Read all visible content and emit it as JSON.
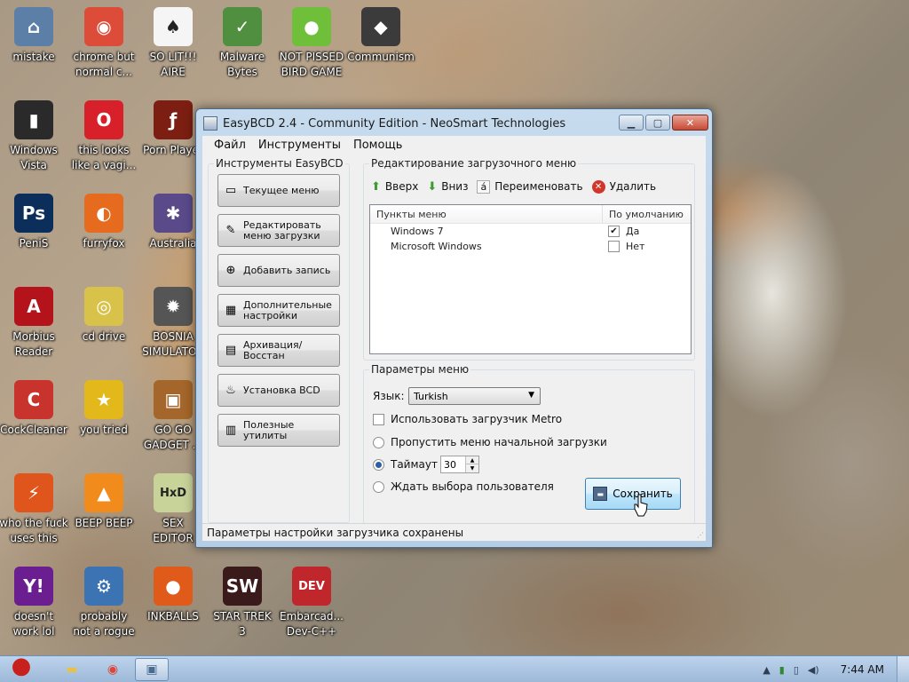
{
  "desktop_icons": [
    {
      "label": "mistake",
      "glyph": "⌂",
      "icon": "computer-icon",
      "bg": "#5c7fa8"
    },
    {
      "label": "chrome but\nnormal c...",
      "glyph": "◉",
      "icon": "chrome-icon",
      "bg": "#dd4b39"
    },
    {
      "label": "SO LIT!!!\nAIRE",
      "glyph": "♠",
      "icon": "solitaire-icon",
      "bg": "#f5f5f5"
    },
    {
      "label": "Malware\nBytes",
      "glyph": "✓",
      "icon": "shield-icon",
      "bg": "#4f8f3f"
    },
    {
      "label": "NOT PISSED\nBIRD GAME",
      "glyph": "●",
      "icon": "pig-icon",
      "bg": "#6fbf3a"
    },
    {
      "label": "Communism",
      "glyph": "◆",
      "icon": "communism-icon",
      "bg": "#3b3b3b"
    },
    {
      "label": "Windows\nVista",
      "glyph": "▮",
      "icon": "trash-icon",
      "bg": "#2a2a2a"
    },
    {
      "label": "this looks\nlike a vagi...",
      "glyph": "O",
      "icon": "opera-icon",
      "bg": "#d8202b"
    },
    {
      "label": "Porn Player",
      "glyph": "ƒ",
      "icon": "flash-icon",
      "bg": "#7c1e12"
    },
    {
      "label": "PeniS",
      "glyph": "Ps",
      "icon": "photoshop-icon",
      "bg": "#0b2f5a"
    },
    {
      "label": "furryfox",
      "glyph": "◐",
      "icon": "firefox-icon",
      "bg": "#e66b1f"
    },
    {
      "label": "Australia",
      "glyph": "✱",
      "icon": "spider-icon",
      "bg": "#5a4a8a"
    },
    {
      "label": "Morbius\nReader",
      "glyph": "A",
      "icon": "pdf-icon",
      "bg": "#b5131b"
    },
    {
      "label": "cd drive",
      "glyph": "◎",
      "icon": "cd-icon",
      "bg": "#d8c24a"
    },
    {
      "label": "BOSNIA\nSIMULATOR",
      "glyph": "✹",
      "icon": "mine-icon",
      "bg": "#555555"
    },
    {
      "label": "CockCleaner",
      "glyph": "C",
      "icon": "ccleaner-icon",
      "bg": "#c8332e"
    },
    {
      "label": "you tried",
      "glyph": "★",
      "icon": "star-icon",
      "bg": "#e3b81b"
    },
    {
      "label": "GO GO\nGADGET ...",
      "glyph": "▣",
      "icon": "gadget-icon",
      "bg": "#a4662a"
    },
    {
      "label": "who the fuck\nuses this",
      "glyph": "⚡",
      "icon": "lightning-icon",
      "bg": "#e0551c"
    },
    {
      "label": "BEEP BEEP",
      "glyph": "▲",
      "icon": "vlc-icon",
      "bg": "#f08b1c"
    },
    {
      "label": "SEX\nEDITOR",
      "glyph": "HxD",
      "icon": "hex-editor-icon",
      "bg": "#c8d39a"
    },
    {
      "label": "doesn't\nwork lol",
      "glyph": "Y!",
      "icon": "yahoo-icon",
      "bg": "#6b1e8f"
    },
    {
      "label": "probably\nnot a rogue",
      "glyph": "⚙",
      "icon": "gear-icon",
      "bg": "#3c74b3"
    },
    {
      "label": "INKBALLS",
      "glyph": "●",
      "icon": "inkball-icon",
      "bg": "#e05a1a"
    },
    {
      "label": "STAR TREK\n3",
      "glyph": "SW",
      "icon": "star-wars-icon",
      "bg": "#3a1a1a"
    },
    {
      "label": "Embarcad...\nDev-C++",
      "glyph": "DEV",
      "icon": "devcpp-icon",
      "bg": "#c0272d"
    }
  ],
  "window": {
    "title": "EasyBCD 2.4 - Community Edition - NeoSmart Technologies",
    "menu": [
      "Файл",
      "Инструменты",
      "Помощь"
    ],
    "tools_group_title": "Инструменты EasyBCD",
    "tools": [
      {
        "label": "Текущее меню",
        "glyph": "▭",
        "name": "view-settings-button"
      },
      {
        "label": "Редактировать\nменю загрузки",
        "glyph": "✎",
        "name": "edit-boot-menu-button"
      },
      {
        "label": "Добавить запись",
        "glyph": "⊕",
        "name": "add-entry-button"
      },
      {
        "label": "Дополнительные\nнастройки",
        "glyph": "▦",
        "name": "advanced-settings-button"
      },
      {
        "label": "Архивация/Восстан",
        "glyph": "▤",
        "name": "backup-restore-button"
      },
      {
        "label": "Установка BCD",
        "glyph": "♨",
        "name": "bcd-deployment-button"
      },
      {
        "label": "Полезные утилиты",
        "glyph": "▥",
        "name": "useful-utilities-button"
      }
    ],
    "edit_group_title": "Редактирование загрузочного меню",
    "toolbar": {
      "up": "Вверх",
      "down": "Вниз",
      "rename": "Переименовать",
      "delete": "Удалить"
    },
    "list": {
      "col_entries": "Пункты меню",
      "col_default": "По умолчанию",
      "rows": [
        {
          "name": "Windows 7",
          "checked": true,
          "default": "Да"
        },
        {
          "name": "Microsoft Windows",
          "checked": false,
          "default": "Нет"
        }
      ]
    },
    "options_group_title": "Параметры меню",
    "language_label": "Язык:",
    "language_value": "Turkish",
    "metro_label": "Использовать загрузчик Metro",
    "skip_label": "Пропустить меню начальной загрузки",
    "timeout_label": "Таймаут",
    "timeout_value": "30",
    "wait_label": "Ждать выбора пользователя",
    "save_label": "Сохранить",
    "status": "Параметры настройки загрузчика сохранены"
  },
  "taskbar": {
    "clock": "7:44 AM"
  }
}
